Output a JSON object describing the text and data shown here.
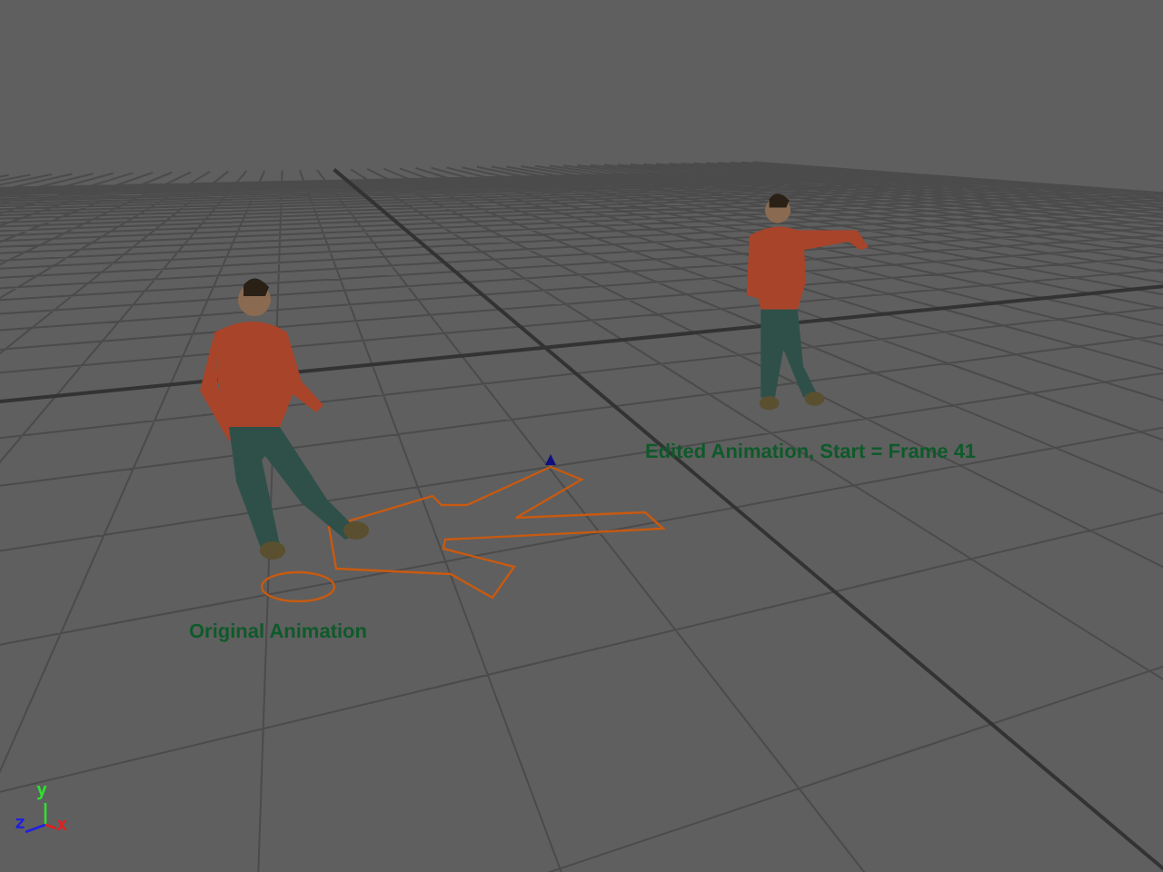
{
  "viewport": {
    "labels": [
      {
        "text": "Original Animation"
      },
      {
        "text": "Edited Animation, Start = Frame 41"
      }
    ],
    "axis_gizmo": {
      "labels": [
        "y",
        "z",
        "x"
      ]
    }
  }
}
